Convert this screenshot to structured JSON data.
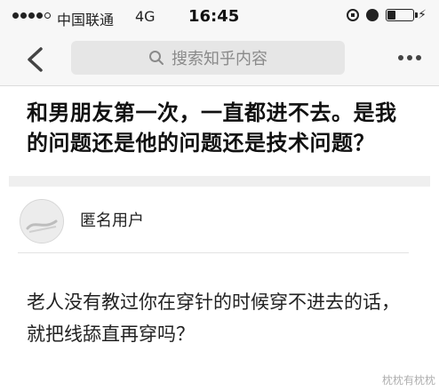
{
  "status_bar": {
    "carrier": "中国联通",
    "network": "4G",
    "time": "16:45",
    "battery_level": 0.3
  },
  "nav": {
    "search_placeholder": "搜索知乎内容"
  },
  "question": {
    "title": "和男朋友第一次，一直都进不去。是我的问题还是他的问题还是技术问题？"
  },
  "answer": {
    "author": "匿名用户",
    "text": "老人没有教过你在穿针的时候穿不进去的话，就把线舔直再穿吗？"
  },
  "watermark": "枕枕有枕枕",
  "icons": {
    "back": "chevron-left-icon",
    "search": "search-icon",
    "more": "more-dots-icon",
    "rotation_lock": "rotation-lock-icon",
    "alarm": "alarm-icon",
    "battery": "battery-icon",
    "charging": "charging-icon"
  }
}
